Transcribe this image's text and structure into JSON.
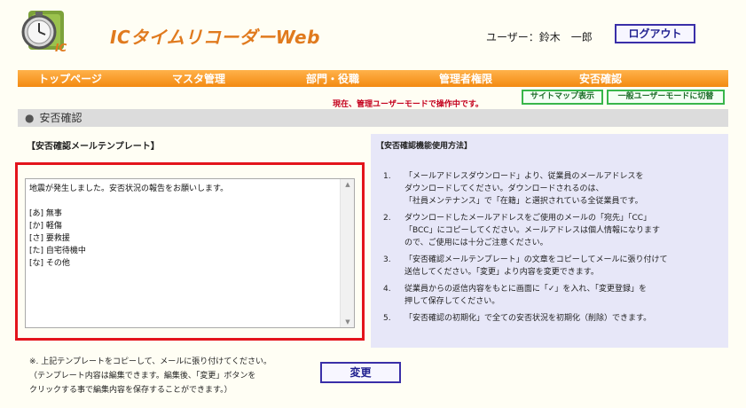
{
  "header": {
    "app_title": "ICタイムリコーダーWeb",
    "user_label": "ユーザー：鈴木　一郎",
    "logout_label": "ログアウト"
  },
  "nav": {
    "items": [
      {
        "label": "トップページ"
      },
      {
        "label": "マスタ管理"
      },
      {
        "label": "部門・役職"
      },
      {
        "label": "管理者権限"
      },
      {
        "label": "安否確認"
      }
    ]
  },
  "mode_notice": "現在、管理ユーザーモードで操作中です。",
  "sub_buttons": {
    "sitemap": "サイトマップ表示",
    "general_mode": "一般ユーザーモードに切替"
  },
  "section_title": "安否確認",
  "template": {
    "title": "【安否確認メールテンプレート】",
    "text": "地震が発生しました。安否状況の報告をお願いします。\n\n[あ] 無事\n[か] 軽傷\n[さ] 要救援\n[た] 自宅待機中\n[な] その他"
  },
  "instructions": {
    "title": "【安否確認機能使用方法】",
    "items": [
      {
        "num": "1.",
        "text": "「メールアドレスダウンロード」より、従業員のメールアドレスを\nダウンロードしてください。ダウンロードされるのは、\n「社員メンテナンス」で「在籍」と選択されている全従業員です。"
      },
      {
        "num": "2.",
        "text": "ダウンロードしたメールアドレスをご使用のメールの「宛先」「CC」\n「BCC」にコピーしてください。メールアドレスは個人情報になります\nので、ご使用には十分ご注意ください。"
      },
      {
        "num": "3.",
        "text": "「安否確認メールテンプレート」の文章をコピーしてメールに張り付けて\n送信してください。「変更」より内容を変更できます。"
      },
      {
        "num": "4.",
        "text": "従業員からの返信内容をもとに画面に「✓」を入れ、「変更登録」を\n押して保存してください。"
      },
      {
        "num": "5.",
        "text": "「安否確認の初期化」で全ての安否状況を初期化（削除）できます。"
      }
    ]
  },
  "footnote": "※. 上記テンプレートをコピーして、メールに張り付けてください。\n（テンプレート内容は編集できます。編集後、「変更」ボタンを\nクリックする事で編集内容を保存することができます。）",
  "change_label": "変更",
  "colors": {
    "nav_orange": "#f38a12",
    "title_orange": "#e07a1e",
    "notice_red": "#c4001d",
    "highlight_red": "#e3141c",
    "button_blue": "#3a2fa8",
    "button_green": "#39b64a",
    "panel_lavender": "#e7e7f8"
  },
  "icons": {
    "logo": "clock-ic-card-logo-icon",
    "scroll_up": "scroll-up-arrow-icon",
    "scroll_down": "scroll-down-arrow-icon"
  }
}
